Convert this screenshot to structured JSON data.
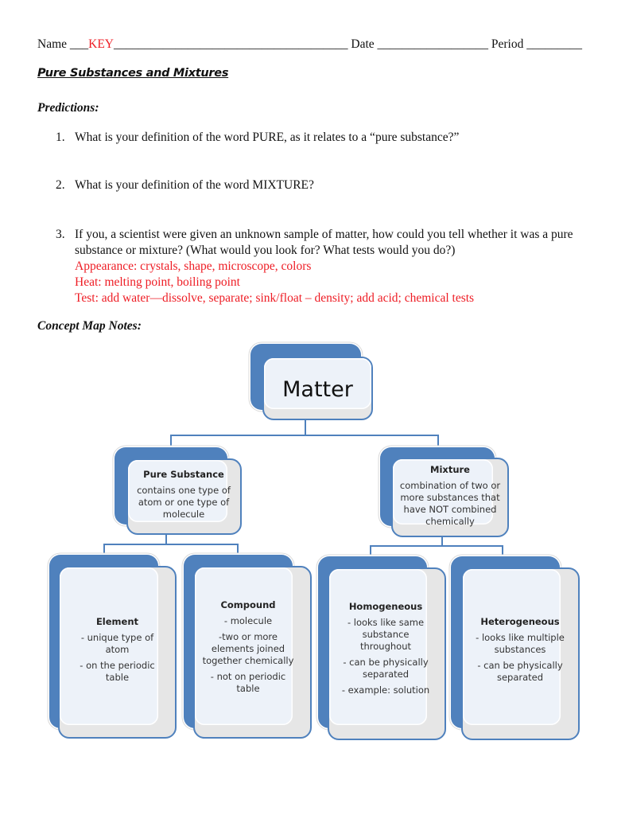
{
  "header": {
    "name_label": "Name",
    "name_prefix_blank": "___",
    "name_value": "KEY",
    "name_suffix_blank": "______________________________________",
    "date_label": "Date",
    "date_blank": "__________________",
    "period_label": "Period",
    "period_blank": "_________"
  },
  "title": "Pure Substances and Mixtures",
  "predictions": {
    "heading": "Predictions:",
    "questions": [
      {
        "number": "1.",
        "text": "What is your definition of the word PURE, as it relates to a “pure substance?”"
      },
      {
        "number": "2.",
        "text": "What is your definition of the word MIXTURE?"
      },
      {
        "number": "3.",
        "text_line1": "If you, a scientist were given an unknown sample of matter, how could you tell whether it was a pure",
        "text_line2": "substance or mixture? (What would you look for? What tests would you do?)",
        "answers": [
          "Appearance: crystals, shape, microscope, colors",
          "Heat: melting point, boiling point",
          "Test: add water—dissolve, separate; sink/float – density; add acid; chemical tests"
        ]
      }
    ]
  },
  "concept_map": {
    "heading": "Concept Map Notes:",
    "root": {
      "title": "Matter"
    },
    "level1": [
      {
        "title": "Pure Substance",
        "lines": [
          "contains one type of atom or one type of molecule"
        ]
      },
      {
        "title": "Mixture",
        "lines": [
          "combination of two or more substances that have NOT combined chemically"
        ]
      }
    ],
    "level2": [
      {
        "title": "Element",
        "lines": [
          "- unique type of atom",
          "- on the periodic table"
        ]
      },
      {
        "title": "Compound",
        "lines": [
          "- molecule",
          "-two or more elements joined together chemically",
          "- not on periodic table"
        ]
      },
      {
        "title": "Homogeneous",
        "lines": [
          "- looks like same substance throughout",
          "- can be physically separated",
          "- example: solution"
        ]
      },
      {
        "title": "Heterogeneous",
        "lines": [
          "- looks like multiple substances",
          "- can be physically separated"
        ]
      }
    ],
    "colors": {
      "accent": "#4f81bd",
      "card_fill": "#edf2f9",
      "shadow_fill": "#e6e6e6"
    }
  }
}
